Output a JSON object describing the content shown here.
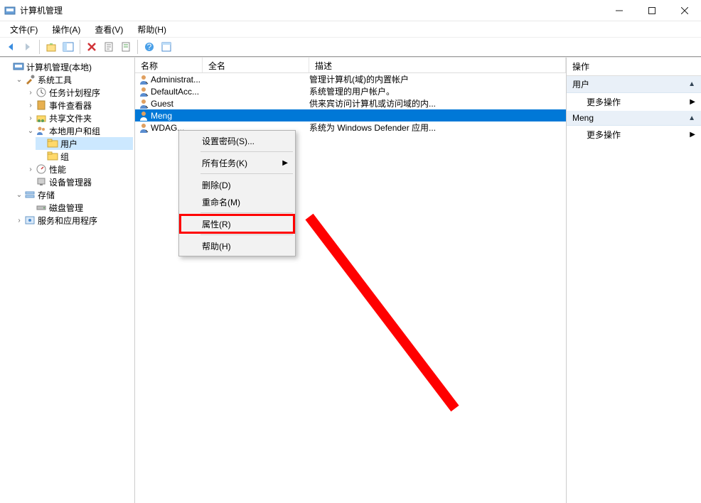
{
  "titlebar": {
    "title": "计算机管理"
  },
  "menubar": {
    "file": "文件(F)",
    "action": "操作(A)",
    "view": "查看(V)",
    "help": "帮助(H)"
  },
  "tree": {
    "root": "计算机管理(本地)",
    "system_tools": "系统工具",
    "task_scheduler": "任务计划程序",
    "event_viewer": "事件查看器",
    "shared_folders": "共享文件夹",
    "local_users": "本地用户和组",
    "users": "用户",
    "groups": "组",
    "performance": "性能",
    "device_manager": "设备管理器",
    "storage": "存储",
    "disk_mgmt": "磁盘管理",
    "services_apps": "服务和应用程序"
  },
  "list": {
    "columns": {
      "name": "名称",
      "full": "全名",
      "desc": "描述"
    },
    "rows": [
      {
        "name": "Administrat...",
        "full": "",
        "desc": "管理计算机(域)的内置帐户"
      },
      {
        "name": "DefaultAcc...",
        "full": "",
        "desc": "系统管理的用户帐户。"
      },
      {
        "name": "Guest",
        "full": "",
        "desc": "供来宾访问计算机或访问域的内..."
      },
      {
        "name": "Meng",
        "full": "",
        "desc": ""
      },
      {
        "name": "WDAG...",
        "full": "",
        "desc": "系统为 Windows Defender 应用..."
      }
    ]
  },
  "context_menu": {
    "set_password": "设置密码(S)...",
    "all_tasks": "所有任务(K)",
    "delete": "删除(D)",
    "rename": "重命名(M)",
    "properties": "属性(R)",
    "help": "帮助(H)"
  },
  "actions": {
    "title": "操作",
    "users_hdr": "用户",
    "meng_hdr": "Meng",
    "more_actions": "更多操作"
  }
}
